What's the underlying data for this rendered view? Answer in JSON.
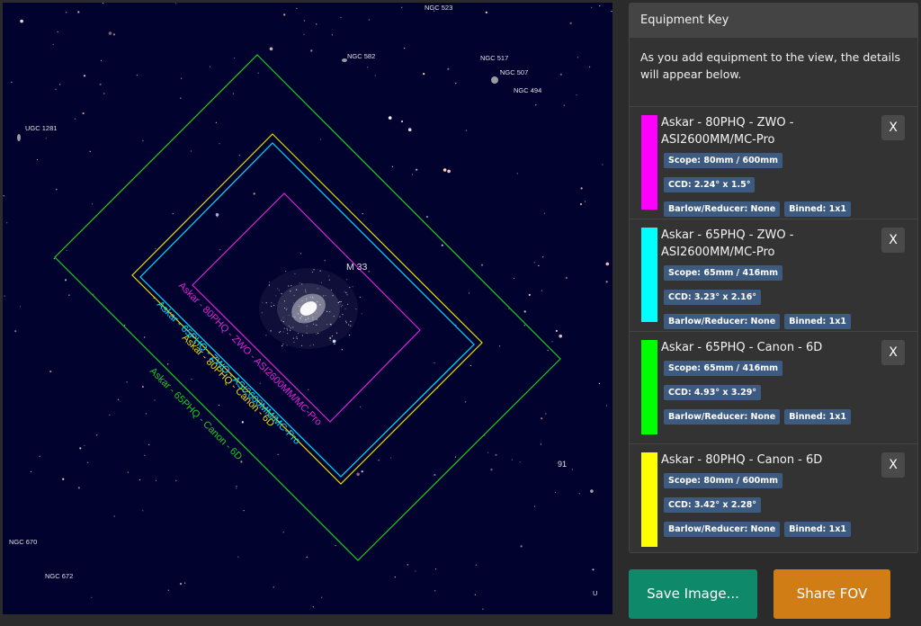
{
  "sky": {
    "objects": [
      "NGC 523",
      "NGC 582",
      "NGC 517",
      "NGC 507",
      "NGC 494",
      "UGC 1281",
      "M 33",
      "91",
      "NGC 670",
      "NGC 672",
      "U"
    ]
  },
  "fov_frames": [
    {
      "label": "Askar - 65PHQ - Canon - 6D",
      "color": "#22cc22"
    },
    {
      "label": "Askar - 80PHQ - Canon - 6D",
      "color": "#e8e000"
    },
    {
      "label": "Askar - 65PHQ - ZWO - ASI2600MM/MC-Pro",
      "color": "#00ddff"
    },
    {
      "label": "Askar - 80PHQ - ZWO - ASI2600MM/MC-Pro",
      "color": "#dd22dd"
    }
  ],
  "panel": {
    "title": "Equipment Key",
    "intro": "As you add equipment to the view, the details will appear below.",
    "remove_label": "X",
    "items": [
      {
        "name": "Askar - 80PHQ - ZWO - ASI2600MM/MC-Pro",
        "color": "#ff00ff",
        "scope": "Scope: 80mm / 600mm",
        "ccd": "CCD: 2.24° x 1.5°",
        "barlow": "Barlow/Reducer: None",
        "binned": "Binned: 1x1"
      },
      {
        "name": "Askar - 65PHQ - ZWO - ASI2600MM/MC-Pro",
        "color": "#00ffff",
        "scope": "Scope: 65mm / 416mm",
        "ccd": "CCD: 3.23° x 2.16°",
        "barlow": "Barlow/Reducer: None",
        "binned": "Binned: 1x1"
      },
      {
        "name": "Askar - 65PHQ - Canon - 6D",
        "color": "#00ff00",
        "scope": "Scope: 65mm / 416mm",
        "ccd": "CCD: 4.93° x 3.29°",
        "barlow": "Barlow/Reducer: None",
        "binned": "Binned: 1x1"
      },
      {
        "name": "Askar - 80PHQ - Canon - 6D",
        "color": "#ffff00",
        "scope": "Scope: 80mm / 600mm",
        "ccd": "CCD: 3.42° x 2.28°",
        "barlow": "Barlow/Reducer: None",
        "binned": "Binned: 1x1"
      }
    ]
  },
  "buttons": {
    "save": "Save Image...",
    "share": "Share FOV"
  }
}
